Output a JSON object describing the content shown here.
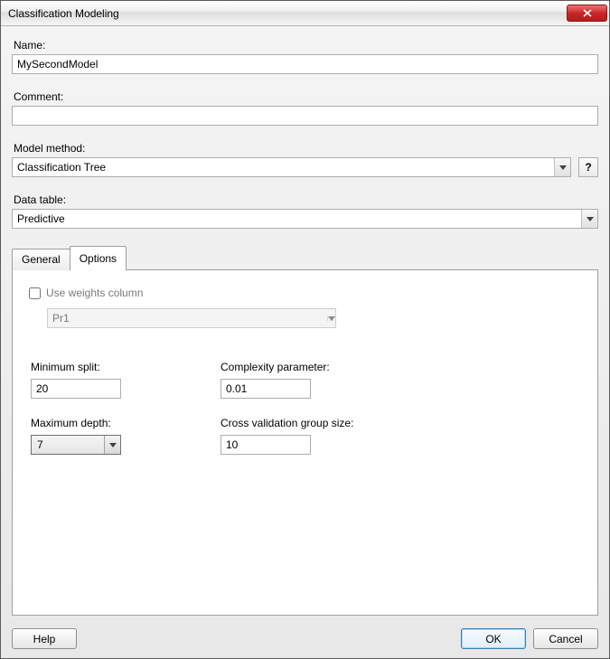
{
  "window": {
    "title": "Classification Modeling"
  },
  "labels": {
    "name": "Name:",
    "comment": "Comment:",
    "model_method": "Model method:",
    "data_table": "Data table:"
  },
  "fields": {
    "name_value": "MySecondModel",
    "comment_value": "",
    "model_method_value": "Classification Tree",
    "data_table_value": "Predictive",
    "help_icon": "?"
  },
  "tabs": {
    "general": "General",
    "options": "Options"
  },
  "options": {
    "use_weights_label": "Use weights column",
    "weights_column_value": "Pr1",
    "min_split_label": "Minimum split:",
    "min_split_value": "20",
    "complexity_label": "Complexity parameter:",
    "complexity_value": "0.01",
    "max_depth_label": "Maximum depth:",
    "max_depth_value": "7",
    "cv_group_label": "Cross validation group size:",
    "cv_group_value": "10"
  },
  "footer": {
    "help": "Help",
    "ok": "OK",
    "cancel": "Cancel"
  }
}
